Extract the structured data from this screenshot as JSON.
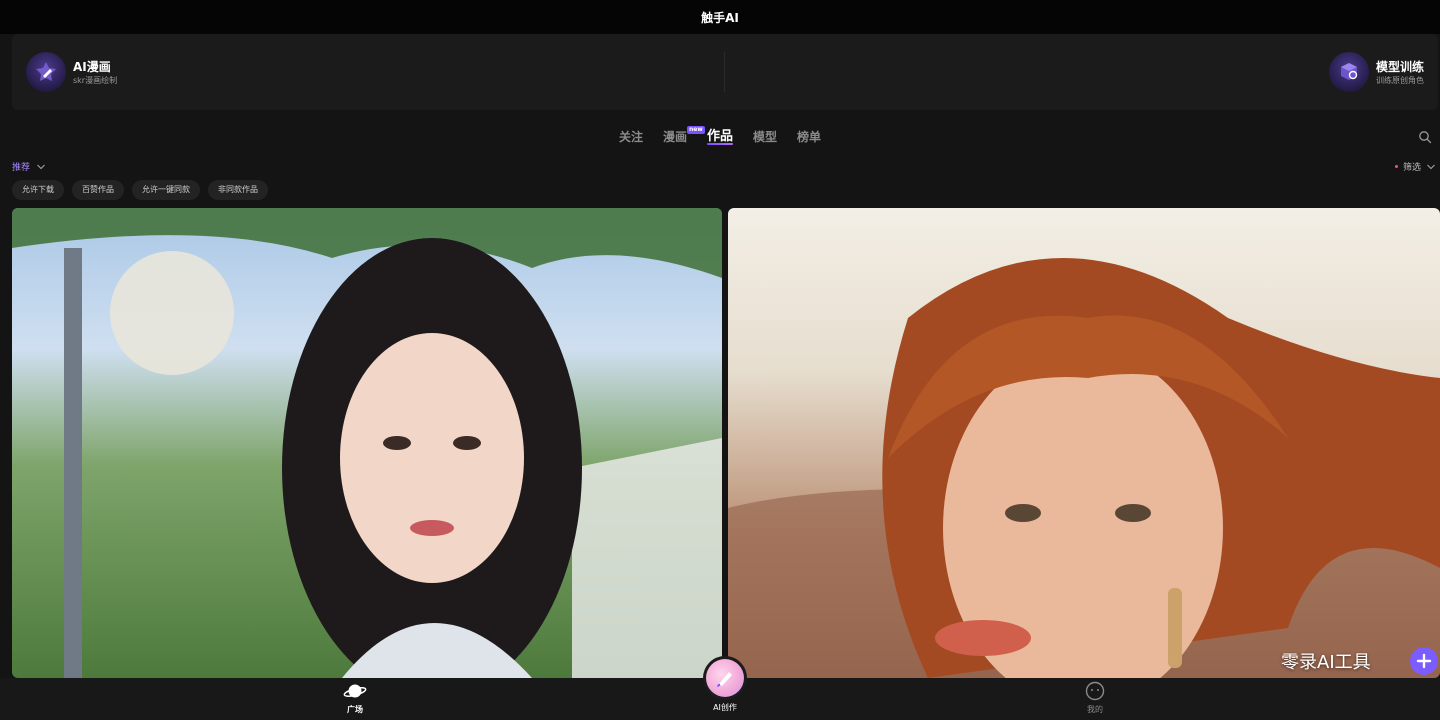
{
  "app": {
    "title": "触手AI"
  },
  "features": {
    "left": {
      "title": "AI漫画",
      "subtitle": "skr漫画绘制",
      "icon": "comic-pen-icon"
    },
    "right": {
      "title": "模型训练",
      "subtitle": "训练原创角色",
      "icon": "model-cube-icon"
    }
  },
  "tabs": [
    {
      "label": "关注",
      "active": false
    },
    {
      "label": "漫画",
      "active": false,
      "badge": "new"
    },
    {
      "label": "作品",
      "active": true
    },
    {
      "label": "模型",
      "active": false
    },
    {
      "label": "榜单",
      "active": false
    }
  ],
  "sort": {
    "label": "推荐"
  },
  "filter": {
    "label": "筛选"
  },
  "chips": [
    "允许下载",
    "百赞作品",
    "允许一键同款",
    "非同款作品"
  ],
  "watermark": "零录AI工具",
  "bottom_nav": {
    "square": "广场",
    "create": "AI创作",
    "mine": "我的"
  },
  "colors": {
    "accent": "#7b5cff",
    "background": "#141414",
    "dot": "#ff4d6a"
  }
}
